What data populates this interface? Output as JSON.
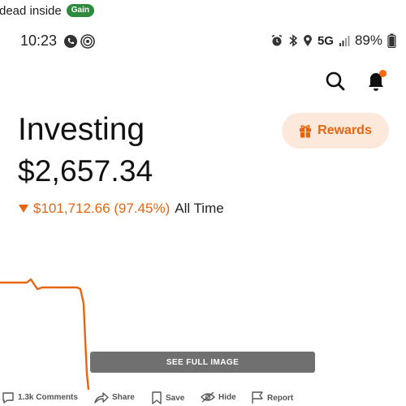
{
  "post": {
    "title": "dead inside",
    "flair": "Gain"
  },
  "statusbar": {
    "time": "10:23",
    "network": "5G",
    "battery": "89%"
  },
  "app": {
    "title": "Investing",
    "balance": "$2,657.34",
    "change": {
      "value": "$101,712.66 (97.45%)",
      "period": "All Time"
    },
    "rewards_label": "Rewards",
    "colors": {
      "accent": "#e8650f",
      "rewards_bg": "#fde9db",
      "line": "#e8650f"
    }
  },
  "see_full_image": "SEE FULL IMAGE",
  "actions": {
    "comments": "1.3k Comments",
    "share": "Share",
    "save": "Save",
    "hide": "Hide",
    "report": "Report"
  },
  "icons": [
    "phone-icon",
    "hotspot-icon",
    "alarm-icon",
    "bluetooth-icon",
    "location-icon",
    "signal-icon",
    "battery-icon",
    "search-icon",
    "bell-icon",
    "gift-icon",
    "down-triangle-icon",
    "comment-icon",
    "share-icon",
    "save-icon",
    "hide-icon",
    "report-icon"
  ]
}
